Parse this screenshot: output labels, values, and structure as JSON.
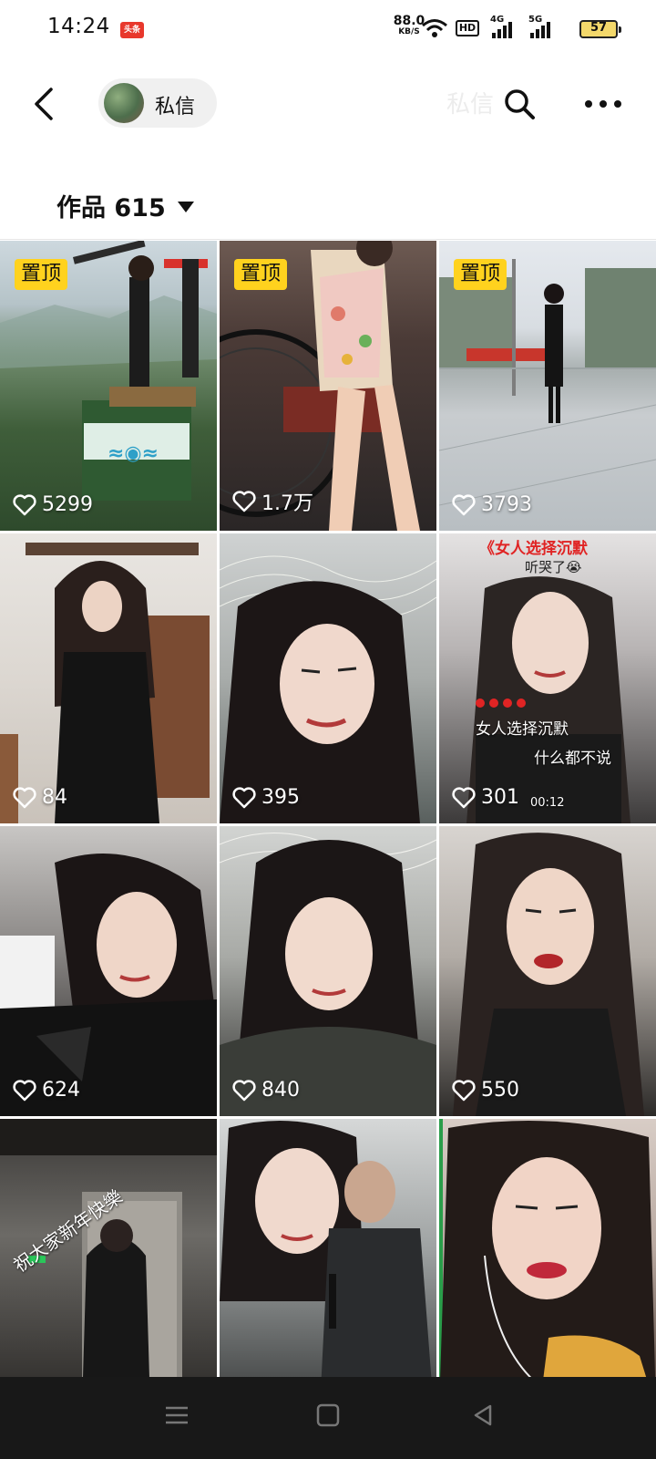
{
  "status_bar": {
    "time": "14:24",
    "app_badge": "头条",
    "net_speed": "88.0",
    "net_unit": "KB/S",
    "hd_label": "HD",
    "sig1_label": "4G",
    "sig2_label": "5G",
    "battery": "57"
  },
  "nav": {
    "dm_label": "私信",
    "ghost_title": "私信"
  },
  "works": {
    "label": "作品 615"
  },
  "pin_label": "置顶",
  "tiles": [
    {
      "likes": "5299"
    },
    {
      "likes": "1.7万"
    },
    {
      "likes": "3793"
    },
    {
      "likes": "84"
    },
    {
      "likes": "395"
    },
    {
      "likes": "301"
    },
    {
      "likes": "624"
    },
    {
      "likes": "840"
    },
    {
      "likes": "550"
    }
  ],
  "overlays": {
    "tile6_title": "《女人选择沉默",
    "tile6_sub": "听哭了😭",
    "tile6_line1": "女人选择沉默",
    "tile6_line2": "什么都不说",
    "tile6_time": "00:12",
    "tile10_text": "祝大家新年快樂"
  },
  "colors": {
    "pin_bg": "#ffd21e",
    "sys_nav_bg": "#181818"
  }
}
